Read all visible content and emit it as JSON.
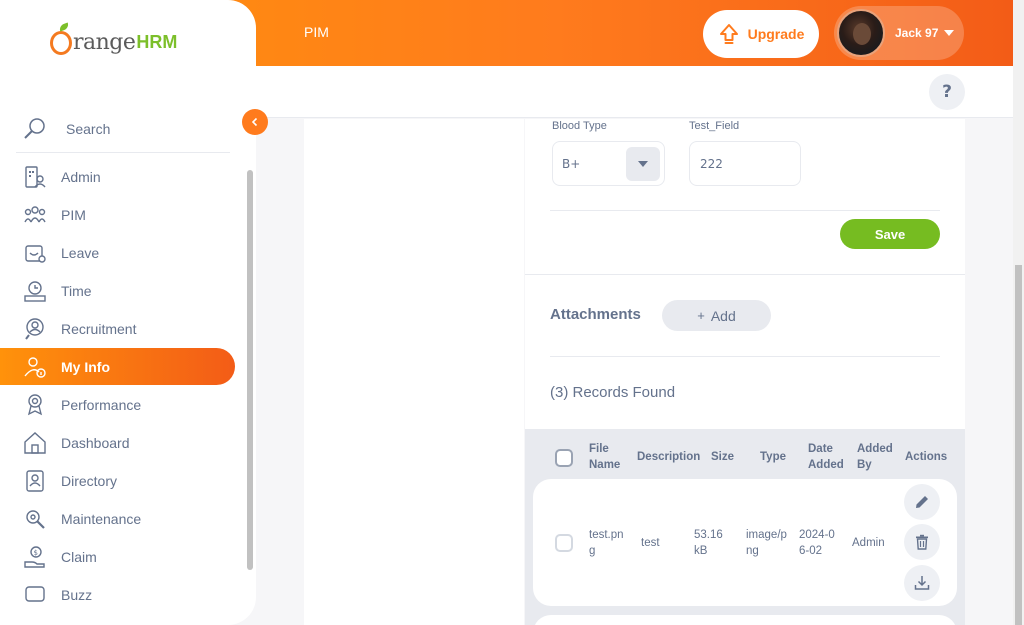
{
  "header": {
    "module_title": "PIM",
    "upgrade_label": "Upgrade",
    "user_name": "Jack 97",
    "help_label": "?"
  },
  "brand": {
    "text1": "range",
    "text2": "HRM"
  },
  "sidebar": {
    "search_label": "Search",
    "items": [
      {
        "label": "Admin",
        "icon": "admin-icon"
      },
      {
        "label": "PIM",
        "icon": "pim-icon"
      },
      {
        "label": "Leave",
        "icon": "leave-icon"
      },
      {
        "label": "Time",
        "icon": "time-icon"
      },
      {
        "label": "Recruitment",
        "icon": "recruitment-icon"
      },
      {
        "label": "My Info",
        "icon": "my-info-icon",
        "active": true
      },
      {
        "label": "Performance",
        "icon": "performance-icon"
      },
      {
        "label": "Dashboard",
        "icon": "dashboard-icon"
      },
      {
        "label": "Directory",
        "icon": "directory-icon"
      },
      {
        "label": "Maintenance",
        "icon": "maintenance-icon"
      },
      {
        "label": "Claim",
        "icon": "claim-icon"
      },
      {
        "label": "Buzz",
        "icon": "buzz-icon"
      }
    ]
  },
  "form": {
    "blood_type_label": "Blood Type",
    "blood_type_value": "B+",
    "test_field_label": "Test_Field",
    "test_field_value": "222",
    "save_label": "Save"
  },
  "attachments": {
    "title": "Attachments",
    "add_label": "Add",
    "records_found": "(3) Records Found",
    "columns": [
      "File Name",
      "Description",
      "Size",
      "Type",
      "Date Added",
      "Added By",
      "Actions"
    ],
    "rows": [
      {
        "file_name": "test.png",
        "description": "test",
        "size": "53.16 kB",
        "type": "image/png",
        "date_added": "2024-06-02",
        "added_by": "Admin"
      }
    ]
  },
  "colors": {
    "brand_orange": "#ff7b1d",
    "save_green": "#76bc21",
    "text": "#64728c"
  }
}
